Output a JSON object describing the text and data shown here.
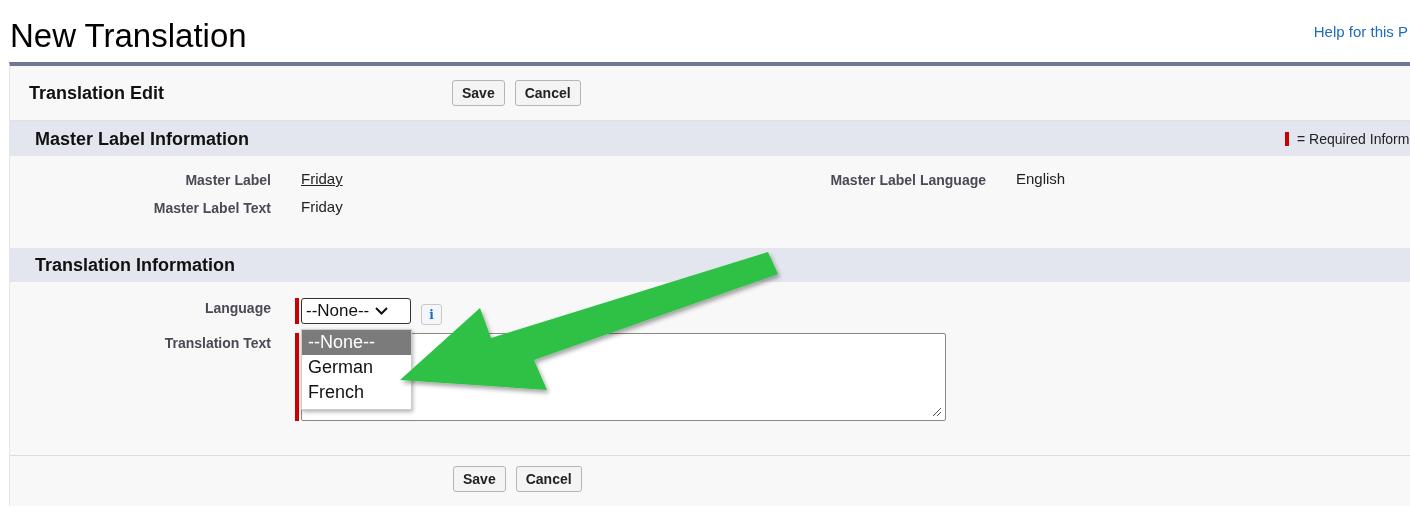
{
  "page": {
    "title": "New Translation",
    "help_link": "Help for this P"
  },
  "panel": {
    "title": "Translation Edit",
    "buttons": [
      "Save",
      "Cancel"
    ],
    "footer_buttons": [
      "Save",
      "Cancel"
    ]
  },
  "master_section": {
    "title": "Master Label Information",
    "required_legend": "= Required Inform",
    "left_fields": [
      {
        "label": "Master Label",
        "value": "Friday",
        "link": true
      },
      {
        "label": "Master Label Text",
        "value": "Friday",
        "link": false
      }
    ],
    "right_fields": [
      {
        "label": "Master Label Language",
        "value": "English",
        "link": false
      }
    ]
  },
  "translation_section": {
    "title": "Translation Information",
    "language": {
      "label": "Language",
      "value": "--None--",
      "required": true,
      "info": "i",
      "options": [
        {
          "label": "--None--",
          "selected": true
        },
        {
          "label": "German",
          "selected": false
        },
        {
          "label": "French",
          "selected": false
        }
      ]
    },
    "translation_text": {
      "label": "Translation Text",
      "required": true
    }
  }
}
